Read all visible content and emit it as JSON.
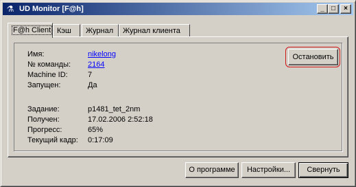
{
  "window": {
    "title": "UD Monitor [F@h]",
    "controls": {
      "minimize": "_",
      "maximize": "□",
      "close": "×"
    }
  },
  "tabs": [
    {
      "label": "F@h Client",
      "active": true
    },
    {
      "label": "Кэш",
      "active": false
    },
    {
      "label": "Журнал",
      "active": false
    },
    {
      "label": "Журнал клиента",
      "active": false
    }
  ],
  "info": {
    "name": {
      "label": "Имя:",
      "value": "nikelong"
    },
    "team": {
      "label": "№ команды:",
      "value": "2164"
    },
    "machine": {
      "label": "Machine ID:",
      "value": "7"
    },
    "running": {
      "label": "Запущен:",
      "value": "Да"
    },
    "task": {
      "label": "Задание:",
      "value": "p1481_tet_2nm"
    },
    "received": {
      "label": "Получен:",
      "value": "17.02.2006 2:52:18"
    },
    "progress": {
      "label": "Прогресс:",
      "value": "65%"
    },
    "frame": {
      "label": "Текущий кадр:",
      "value": "0:17:09"
    }
  },
  "buttons": {
    "stop": "Остановить",
    "about": "О программе",
    "settings": "Настройки...",
    "minimize": "Свернуть"
  },
  "colors": {
    "title_start": "#0a246a",
    "title_end": "#a6caf0",
    "link": "#0000ff",
    "highlight": "#d01515"
  }
}
